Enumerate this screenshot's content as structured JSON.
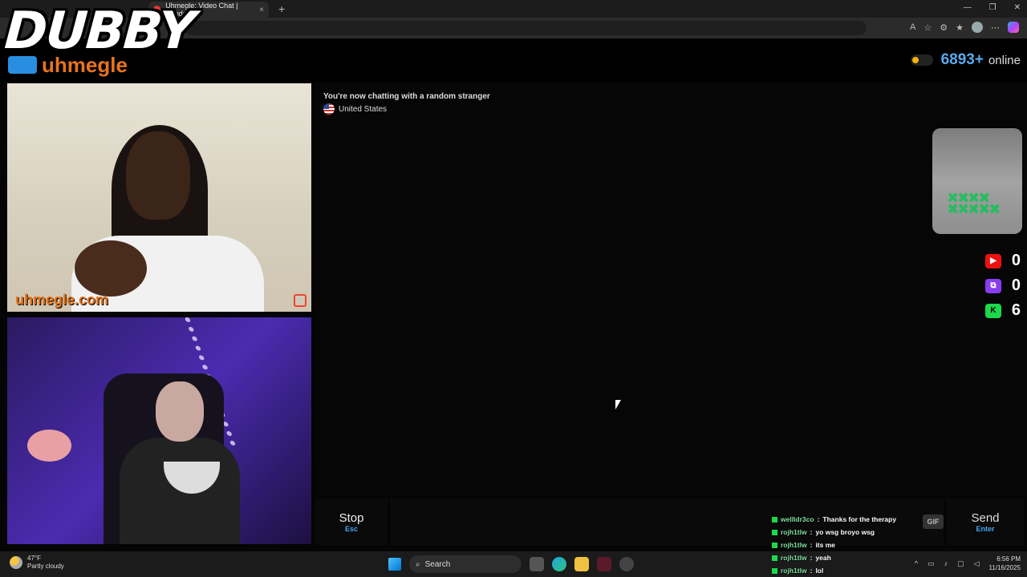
{
  "browser": {
    "tab_title": "Uhmegle: Video Chat | Rando",
    "tab_close": "×",
    "new_tab": "+",
    "window_controls": [
      "—",
      "❐",
      "✕"
    ]
  },
  "overlay": {
    "streamer_logo": "DUBBY"
  },
  "site": {
    "logo_text": "uhmegle",
    "online_count": "6893+",
    "online_label": "online"
  },
  "video": {
    "watermark": "uhmegle.com"
  },
  "chat": {
    "status": "You're now chatting with a random stranger",
    "country": "United States"
  },
  "counters": [
    {
      "platform": "youtube",
      "icon": "▶",
      "value": "0"
    },
    {
      "platform": "twitch",
      "icon": "⧉",
      "value": "0"
    },
    {
      "platform": "kick",
      "icon": "K",
      "value": "6"
    }
  ],
  "controls": {
    "stop_label": "Stop",
    "stop_hint": "Esc",
    "gif_label": "GIF",
    "send_label": "Send",
    "send_hint": "Enter"
  },
  "stream_chat": [
    {
      "user": "wellldr3co",
      "message": "Thanks for the therapy"
    },
    {
      "user": "rojh1tlw",
      "message": "yo wsg broyo wsg"
    },
    {
      "user": "rojh1tlw",
      "message": "its me"
    },
    {
      "user": "rojh1tlw",
      "message": "yeah"
    },
    {
      "user": "rojh1tlw",
      "message": "lol"
    }
  ],
  "taskbar": {
    "weather_temp": "47°F",
    "weather_desc": "Partly cloudy",
    "search_label": "Search",
    "time": "6:56 PM",
    "date": "11/16/2025"
  }
}
